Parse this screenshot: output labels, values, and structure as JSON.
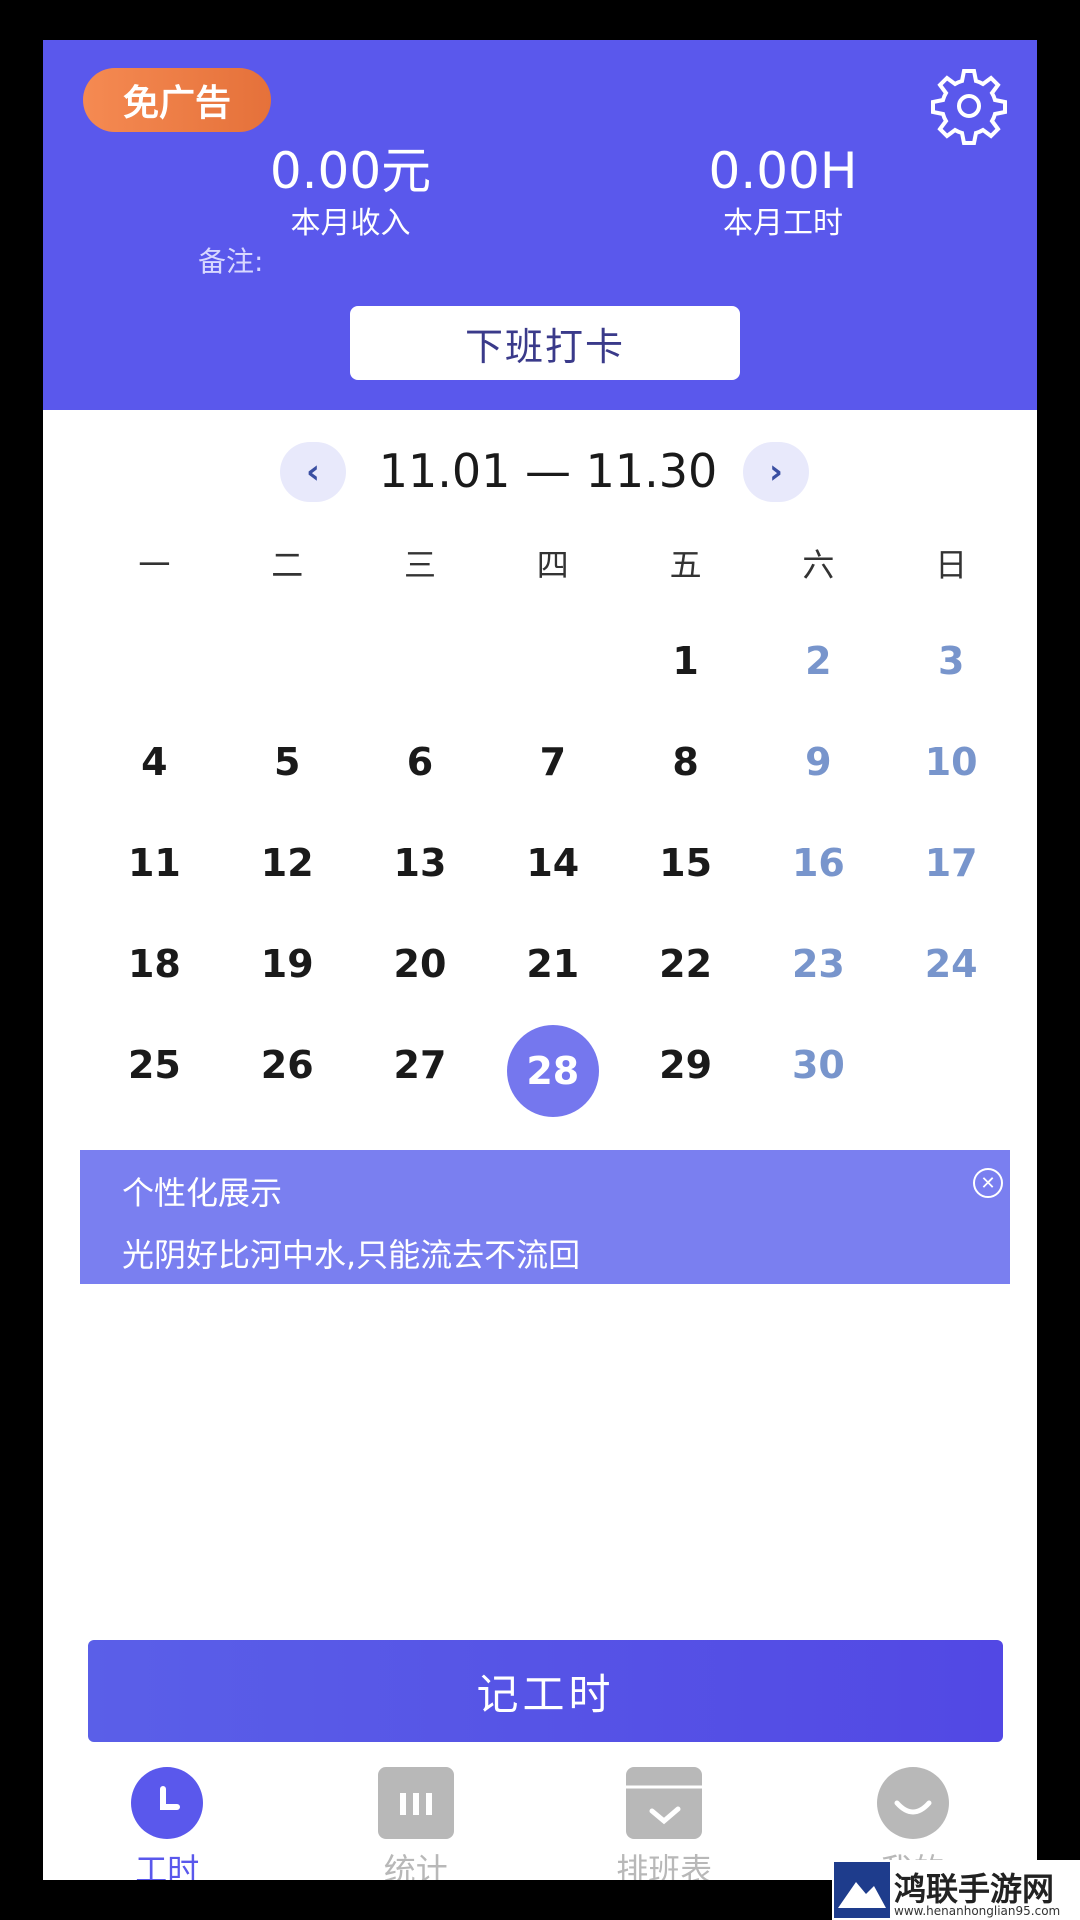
{
  "header": {
    "ad_button": "免广告",
    "income_value": "0.00元",
    "income_label": "本月收入",
    "hours_value": "0.00H",
    "hours_label": "本月工时",
    "note_label": "备注:",
    "clock_out_button": "下班打卡",
    "accent_color": "#5a58ec"
  },
  "calendar": {
    "prev_arrow": "‹",
    "next_arrow": "›",
    "range": "11.01 — 11.30",
    "weekdays": [
      "一",
      "二",
      "三",
      "四",
      "五",
      "六",
      "日"
    ],
    "days": [
      "",
      "",
      "",
      "",
      "1",
      "2",
      "3",
      "4",
      "5",
      "6",
      "7",
      "8",
      "9",
      "10",
      "11",
      "12",
      "13",
      "14",
      "15",
      "16",
      "17",
      "18",
      "19",
      "20",
      "21",
      "22",
      "23",
      "24",
      "25",
      "26",
      "27",
      "28",
      "29",
      "30",
      ""
    ],
    "today": "28"
  },
  "banner": {
    "title": "个性化展示",
    "text": "光阴好比河中水,只能流去不流回",
    "close_icon": "close-circle-icon"
  },
  "record_button": "记工时",
  "tabs": [
    {
      "label": "工时",
      "icon": "clock-icon",
      "active": true
    },
    {
      "label": "统计",
      "icon": "stats-icon",
      "active": false
    },
    {
      "label": "排班表",
      "icon": "schedule-icon",
      "active": false
    },
    {
      "label": "我的",
      "icon": "profile-icon",
      "active": false
    }
  ],
  "watermark": {
    "title": "鸿联手游网",
    "url": "www.henanhonglian95.com"
  }
}
